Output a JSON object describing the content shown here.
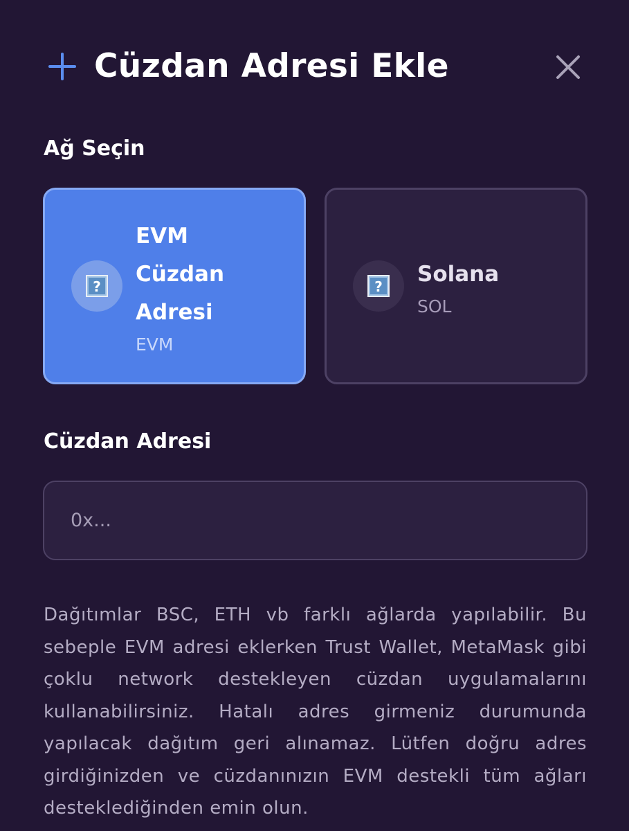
{
  "dialog": {
    "title": "Cüzdan Adresi Ekle",
    "plus_icon": "plus-icon",
    "close_icon": "close-icon"
  },
  "network": {
    "section_label": "Ağ Seçin",
    "options": [
      {
        "name": "EVM Cüzdan Adresi",
        "sub": "EVM",
        "selected": true,
        "icon": "unknown-image-icon"
      },
      {
        "name": "Solana",
        "sub": "SOL",
        "selected": false,
        "icon": "unknown-image-icon"
      }
    ]
  },
  "address": {
    "label": "Cüzdan Adresi",
    "placeholder": "0x...",
    "value": ""
  },
  "note": "Dağıtımlar BSC, ETH vb farklı ağlarda yapılabilir. Bu sebeple EVM adresi eklerken Trust Wallet, MetaMask gibi çoklu network destekleyen cüzdan uygulamalarını kullanabilirsiniz. Hatalı adres girmeniz durumunda yapılacak dağıtım geri alınamaz. Lütfen doğru adres girdiğinizden ve cüzdanınızın EVM destekli tüm ağları desteklediğinden emin olun.",
  "colors": {
    "background": "#221634",
    "accent": "#4f7fe9",
    "card": "#2c2040",
    "muted_text": "#b4acc4"
  }
}
